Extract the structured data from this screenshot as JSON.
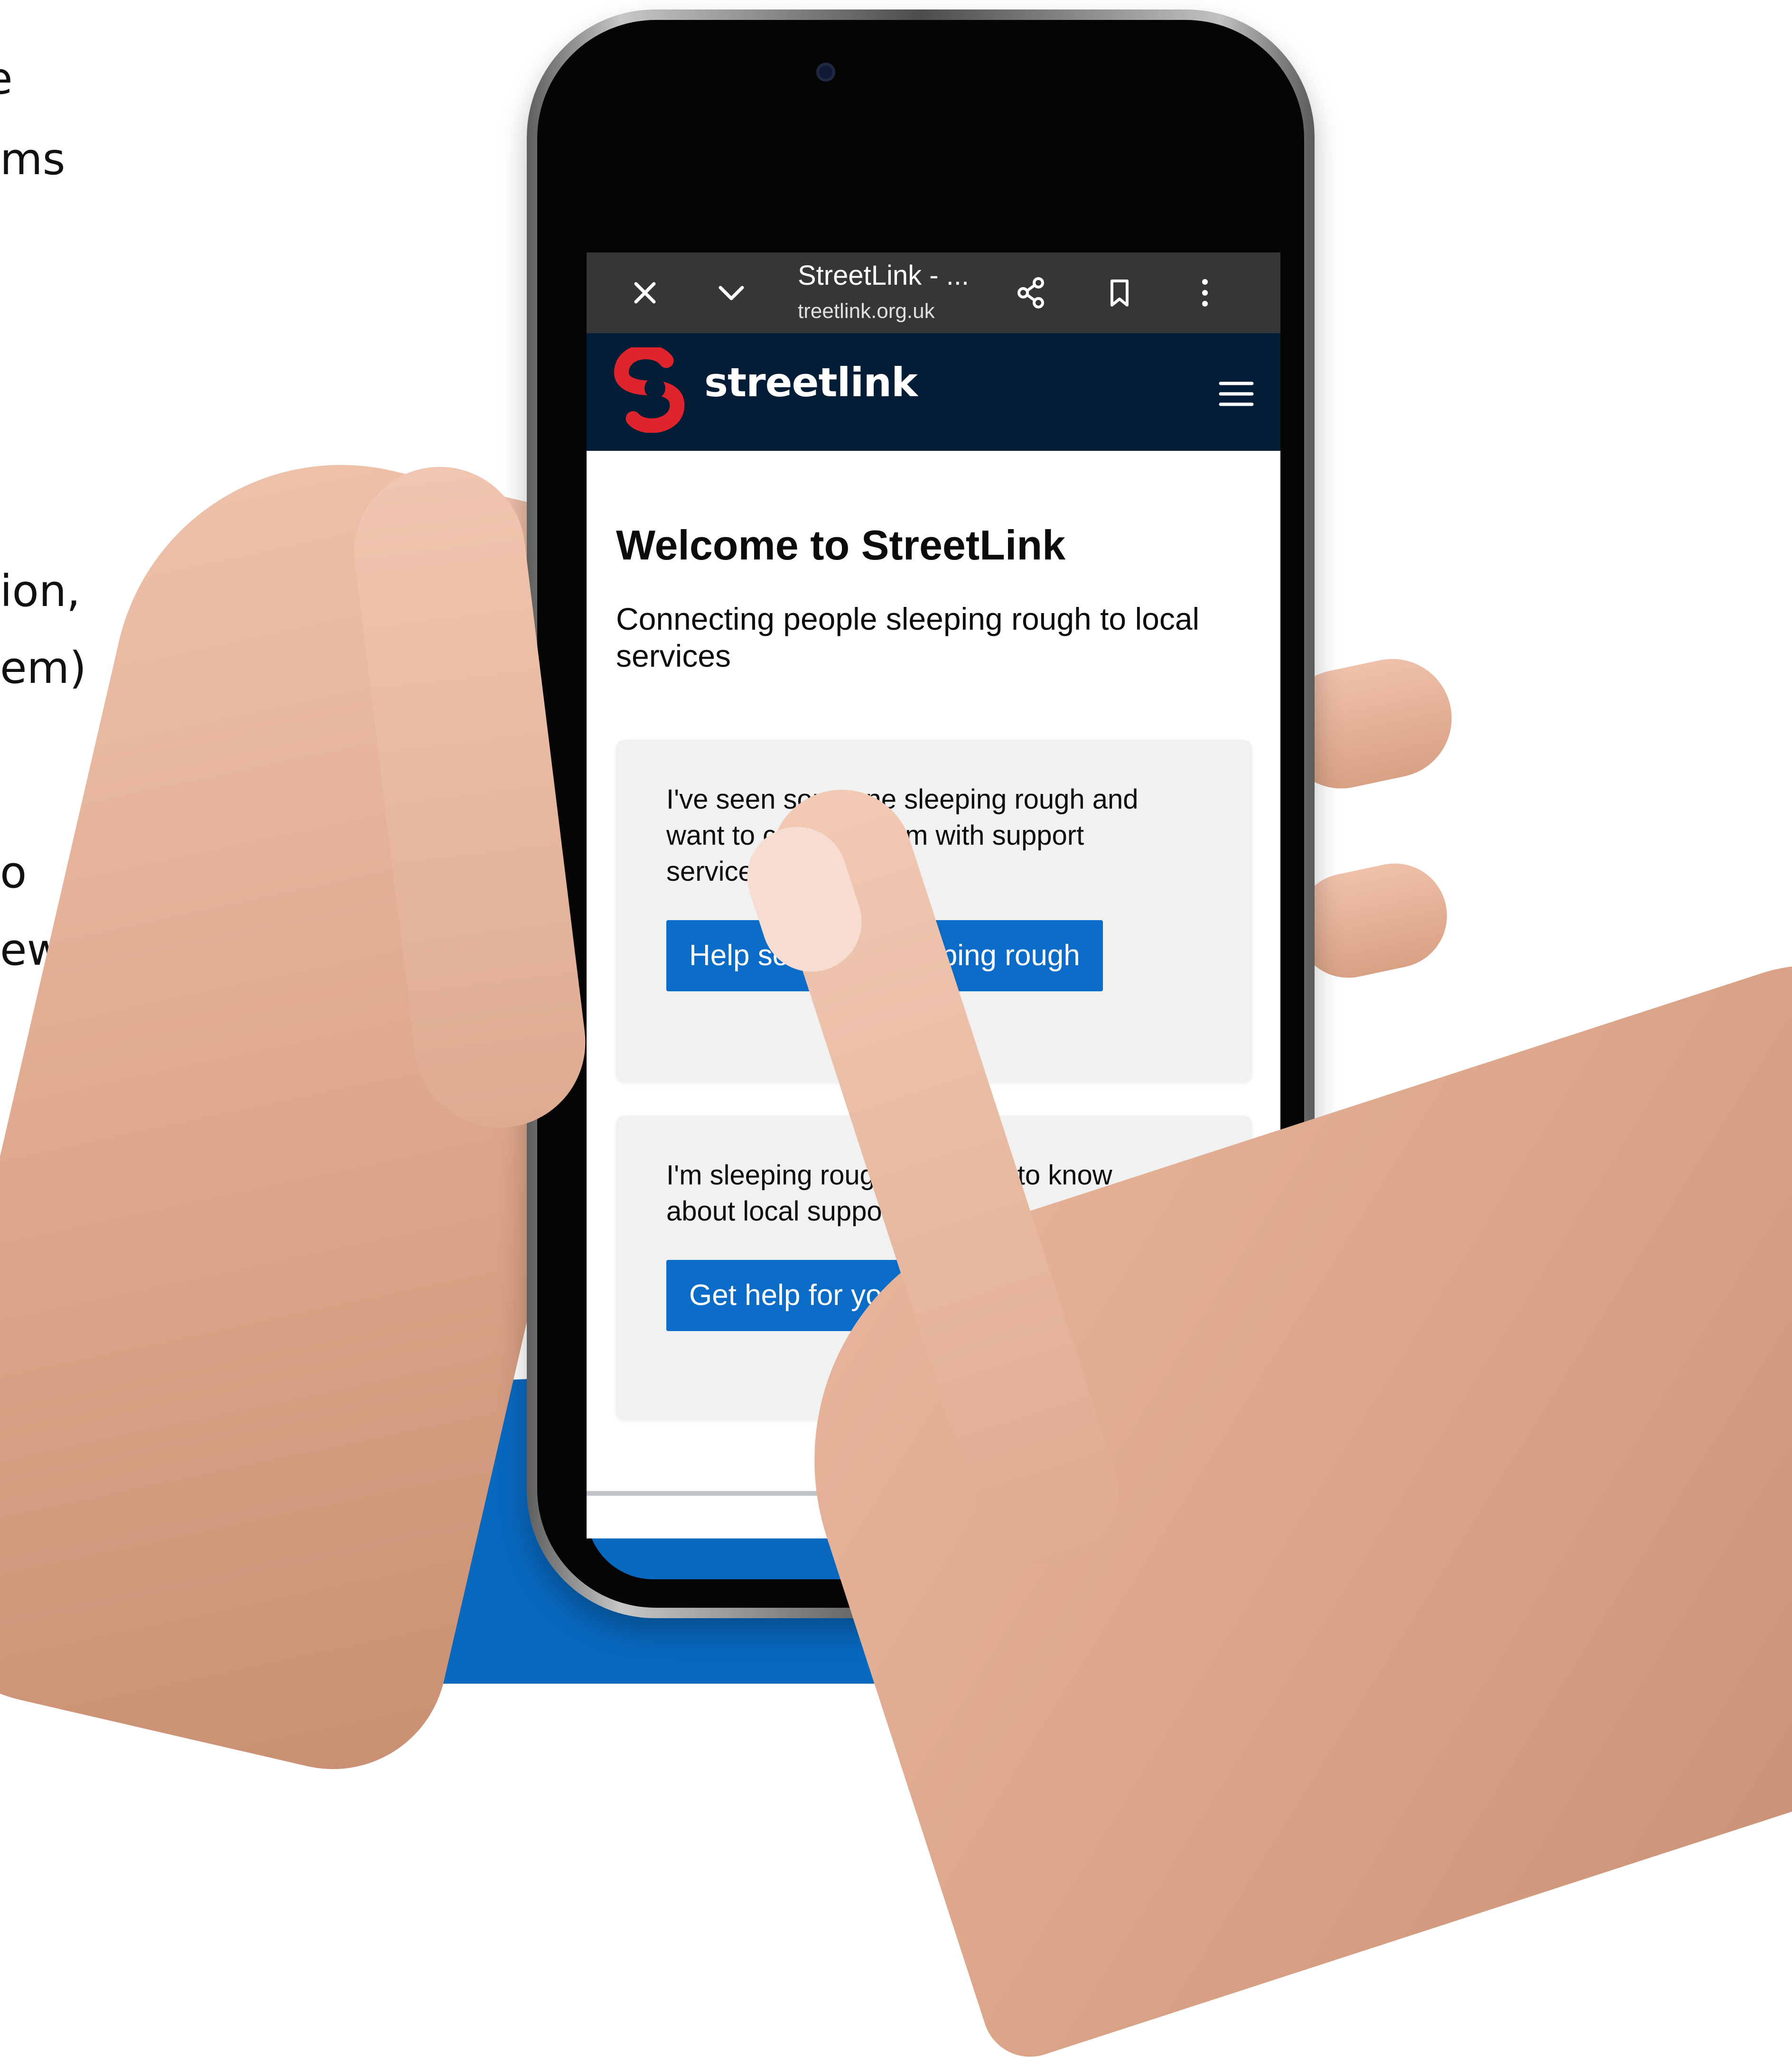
{
  "background": {
    "left_fragments": [
      "e",
      "ms",
      "ion,",
      "em)",
      "o",
      "ew"
    ]
  },
  "browser": {
    "tab_title": "StreetLink - ...",
    "url": "treetlink.org.uk",
    "icons": [
      "close-icon",
      "chevron-down-icon",
      "share-icon",
      "bookmark-icon",
      "more-vertical-icon"
    ]
  },
  "site": {
    "logo_text": "streetlink",
    "menu_icon": "hamburger-icon",
    "brand_colors": {
      "header": "#041d36",
      "logo": "#e0242d",
      "button": "#0b6cc7"
    }
  },
  "page": {
    "title": "Welcome to StreetLink",
    "subtitle": "Connecting people sleeping rough to local services"
  },
  "cards": [
    {
      "text": "I've seen someone sleeping rough and want to connect them with support services",
      "button": "Help someone sleeping rough"
    },
    {
      "text": "I'm sleeping rough and want to know about local support services",
      "button": "Get help for yourself"
    }
  ]
}
